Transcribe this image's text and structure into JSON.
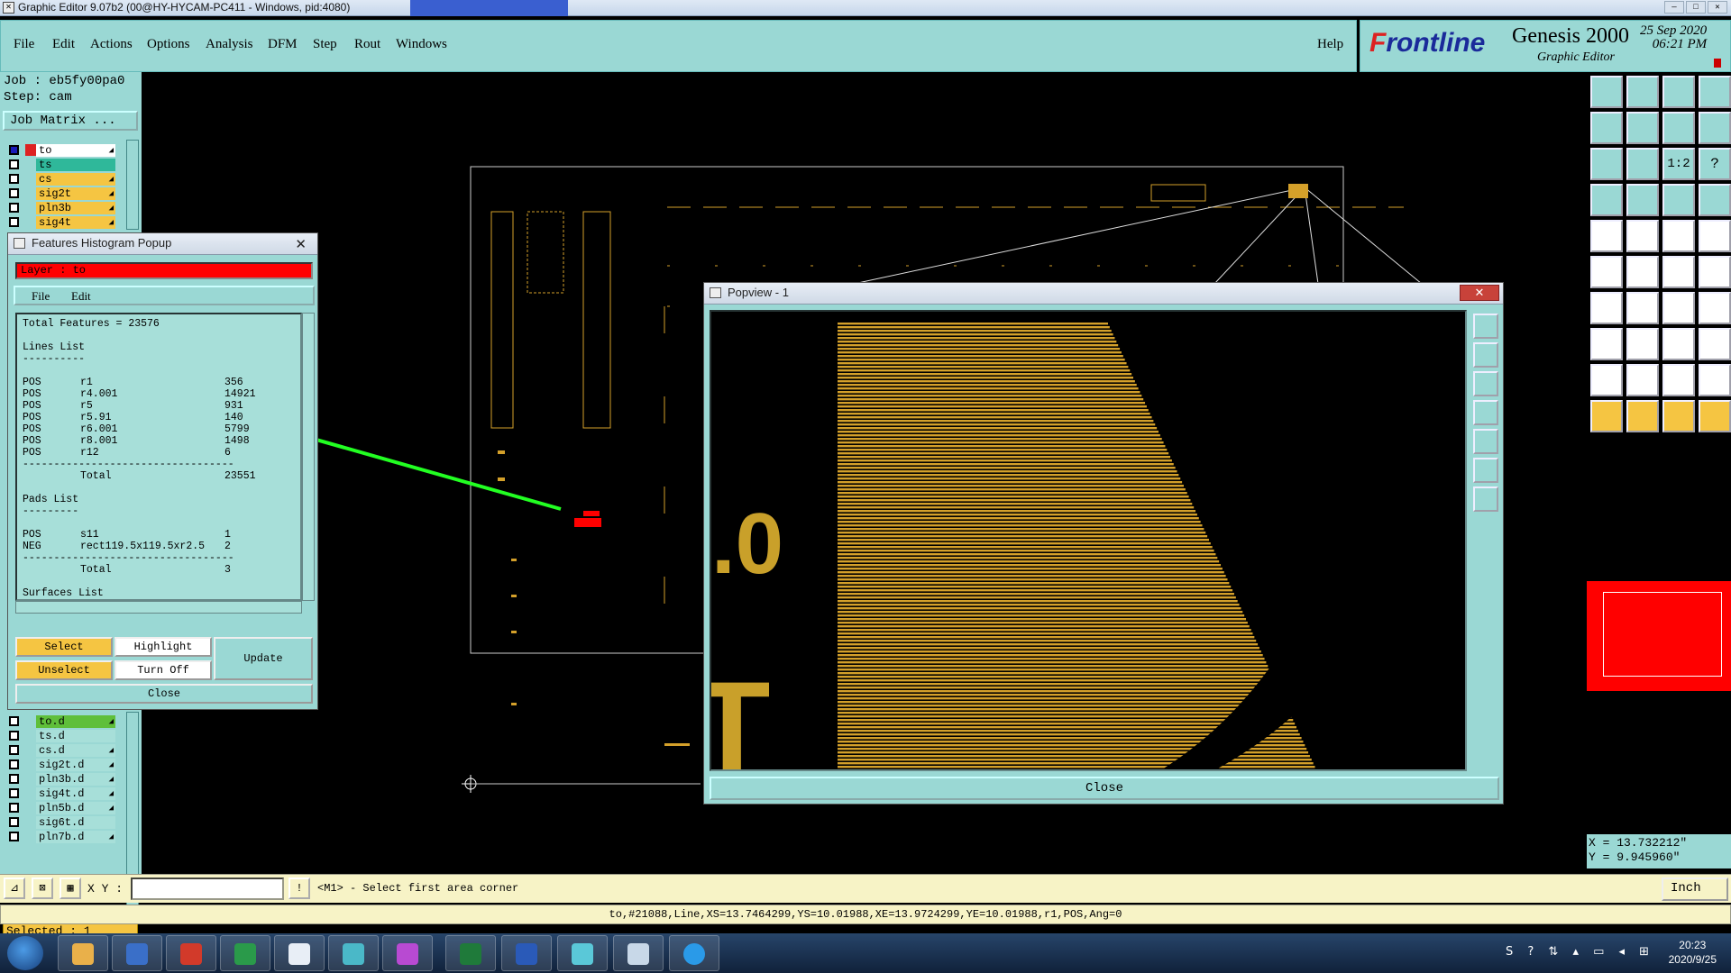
{
  "window": {
    "title": "Graphic Editor 9.07b2 (00@HY-HYCAM-PC411 - Windows, pid:4080)"
  },
  "menu": {
    "items": [
      "File",
      "Edit",
      "Actions",
      "Options",
      "Analysis",
      "DFM",
      "Step",
      "Rout",
      "Windows"
    ],
    "help": "Help"
  },
  "brand": {
    "logo_f": "F",
    "logo_rest": "rontline",
    "product": "Genesis 2000",
    "subtitle": "Graphic Editor",
    "date": "25 Sep 2020",
    "time": "06:21 PM"
  },
  "job": {
    "job": "Job : eb5fy00pa0",
    "step": "Step: cam",
    "matrix_button": "Job Matrix ..."
  },
  "layers_top": [
    {
      "name": "to",
      "color": "#ffffff"
    },
    {
      "name": "ts",
      "color": "#2fb89a"
    },
    {
      "name": "cs",
      "color": "#f5c542"
    },
    {
      "name": "sig2t",
      "color": "#f5c542"
    },
    {
      "name": "pln3b",
      "color": "#f5c542"
    },
    {
      "name": "sig4t",
      "color": "#f5c542"
    }
  ],
  "layers_bottom": [
    {
      "name": "to.d",
      "color": "#5fbf3a"
    },
    {
      "name": "ts.d",
      "color": "#a7dfd9"
    },
    {
      "name": "cs.d",
      "color": "#a7dfd9"
    },
    {
      "name": "sig2t.d",
      "color": "#a7dfd9"
    },
    {
      "name": "pln3b.d",
      "color": "#a7dfd9"
    },
    {
      "name": "sig4t.d",
      "color": "#a7dfd9"
    },
    {
      "name": "pln5b.d",
      "color": "#a7dfd9"
    },
    {
      "name": "sig6t.d",
      "color": "#a7dfd9"
    },
    {
      "name": "pln7b.d",
      "color": "#a7dfd9"
    }
  ],
  "selected": "Selected : 1",
  "histogram": {
    "title": "Features Histogram Popup",
    "layer": "Layer : to",
    "menu": [
      "File",
      "Edit"
    ],
    "total_features": "Total Features = 23576",
    "lines_header": "Lines List",
    "lines": [
      {
        "pol": "POS",
        "sym": "r1",
        "count": "356"
      },
      {
        "pol": "POS",
        "sym": "r4.001",
        "count": "14921"
      },
      {
        "pol": "POS",
        "sym": "r5",
        "count": "931"
      },
      {
        "pol": "POS",
        "sym": "r5.91",
        "count": "140"
      },
      {
        "pol": "POS",
        "sym": "r6.001",
        "count": "5799"
      },
      {
        "pol": "POS",
        "sym": "r8.001",
        "count": "1498"
      },
      {
        "pol": "POS",
        "sym": "r12",
        "count": "6"
      }
    ],
    "lines_total_label": "Total",
    "lines_total": "23551",
    "pads_header": "Pads List",
    "pads": [
      {
        "pol": "POS",
        "sym": "s11",
        "count": "1"
      },
      {
        "pol": "NEG",
        "sym": "rect119.5x119.5xr2.5",
        "count": "2"
      }
    ],
    "pads_total_label": "Total",
    "pads_total": "3",
    "surfaces_header": "Surfaces List",
    "buttons": {
      "select": "Select",
      "highlight": "Highlight",
      "update": "Update",
      "unselect": "Unselect",
      "turn_off": "Turn Off",
      "close": "Close"
    }
  },
  "popview": {
    "title": "Popview - 1",
    "close": "Close",
    "close_x": "✕",
    "glyph_a": ".0",
    "glyph_b": "T"
  },
  "coords": {
    "x": "X = 13.732212\"",
    "y": "Y = 9.945960\""
  },
  "command": {
    "xy_label": "X Y :",
    "input_value": "",
    "prompt": "<M1> - Select first area corner",
    "unit": "Inch"
  },
  "status": "to,#21088,Line,XS=13.7464299,YS=10.01988,XE=13.9724299,YE=10.01988,r1,POS,Ang=0",
  "taskbar": {
    "time": "20:23",
    "date": "2020/9/25"
  },
  "colors": {
    "teal": "#9ad8d4",
    "copper": "#d4a02a",
    "yellow_cmd": "#f7f3c6",
    "selected_red": "#ff0000",
    "green_arrow": "#22ff22"
  }
}
